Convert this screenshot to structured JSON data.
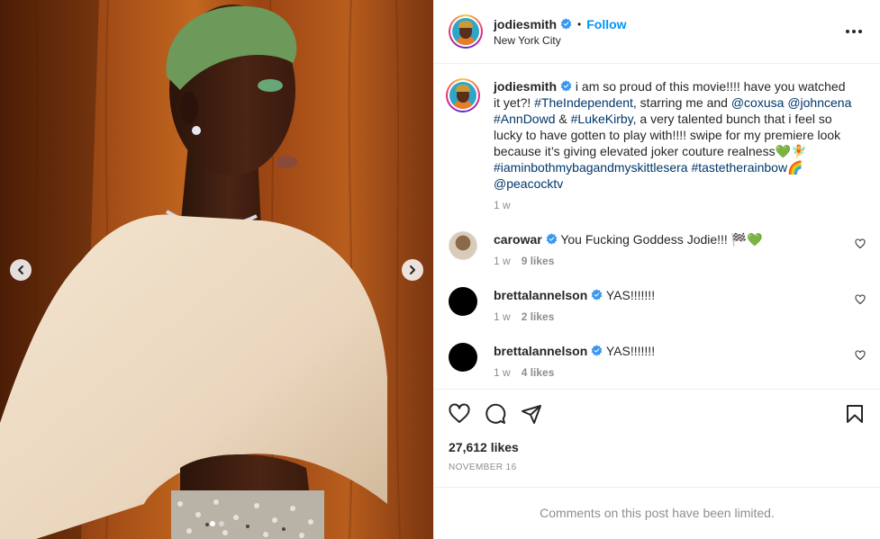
{
  "post": {
    "username": "jodiesmith",
    "follow_label": "Follow",
    "separator": "•",
    "location": "New York City"
  },
  "caption": {
    "username": "jodiesmith",
    "parts": {
      "p1": " i am so proud of this movie!!!! have you watched it yet?! ",
      "tag1": "#TheIndependent",
      "p2": ", starring me and ",
      "tag2": "@coxusa",
      "p3": " ",
      "tag3": "@johncena",
      "p4": " ",
      "tag4": "#AnnDowd",
      "p5": " & ",
      "tag5": "#LukeKirby",
      "p6": ", a very talented bunch that i feel so lucky to have gotten to play with!!!! swipe for my premiere look because it’s giving elevated joker couture realness💚🧚 ",
      "tag6": "#iaminbothmybagandmyskittlesera",
      "p7": " ",
      "tag7": "#tastetherainbow",
      "p8": "🌈 ",
      "tag8": "@peacocktv"
    },
    "time": "1 w"
  },
  "comments": [
    {
      "username": "carowar",
      "text": " You Fucking Goddess Jodie!!! 🏁💚",
      "time": "1 w",
      "likes": "9 likes"
    },
    {
      "username": "brettalannelson",
      "text": " YAS!!!!!!!",
      "time": "1 w",
      "likes": "2 likes"
    },
    {
      "username": "brettalannelson",
      "text": " YAS!!!!!!!",
      "time": "1 w",
      "likes": "4 likes"
    }
  ],
  "likes_count": "27,612 likes",
  "date": "NOVEMBER 16",
  "limited_notice": "Comments on this post have been limited.",
  "icons": {
    "like": "heart-icon",
    "comment": "comment-icon",
    "share": "send-icon",
    "save": "bookmark-icon",
    "more": "more-options-icon",
    "verified": "verified-badge-icon",
    "prev": "chevron-left-icon",
    "next": "chevron-right-icon"
  },
  "colors": {
    "accent": "#0095f6",
    "hashtag": "#00376b",
    "muted": "#8e8e8e",
    "verified": "#3897f0"
  },
  "carousel": {
    "current": 1,
    "total": 2
  }
}
